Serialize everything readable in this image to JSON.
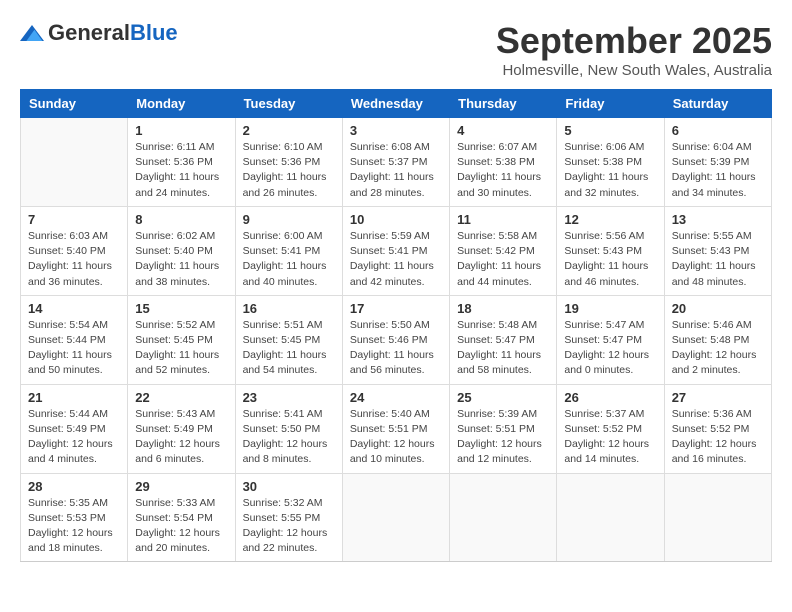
{
  "header": {
    "logo_general": "General",
    "logo_blue": "Blue",
    "month": "September 2025",
    "location": "Holmesville, New South Wales, Australia"
  },
  "weekdays": [
    "Sunday",
    "Monday",
    "Tuesday",
    "Wednesday",
    "Thursday",
    "Friday",
    "Saturday"
  ],
  "weeks": [
    [
      {
        "day": "",
        "info": ""
      },
      {
        "day": "1",
        "info": "Sunrise: 6:11 AM\nSunset: 5:36 PM\nDaylight: 11 hours\nand 24 minutes."
      },
      {
        "day": "2",
        "info": "Sunrise: 6:10 AM\nSunset: 5:36 PM\nDaylight: 11 hours\nand 26 minutes."
      },
      {
        "day": "3",
        "info": "Sunrise: 6:08 AM\nSunset: 5:37 PM\nDaylight: 11 hours\nand 28 minutes."
      },
      {
        "day": "4",
        "info": "Sunrise: 6:07 AM\nSunset: 5:38 PM\nDaylight: 11 hours\nand 30 minutes."
      },
      {
        "day": "5",
        "info": "Sunrise: 6:06 AM\nSunset: 5:38 PM\nDaylight: 11 hours\nand 32 minutes."
      },
      {
        "day": "6",
        "info": "Sunrise: 6:04 AM\nSunset: 5:39 PM\nDaylight: 11 hours\nand 34 minutes."
      }
    ],
    [
      {
        "day": "7",
        "info": "Sunrise: 6:03 AM\nSunset: 5:40 PM\nDaylight: 11 hours\nand 36 minutes."
      },
      {
        "day": "8",
        "info": "Sunrise: 6:02 AM\nSunset: 5:40 PM\nDaylight: 11 hours\nand 38 minutes."
      },
      {
        "day": "9",
        "info": "Sunrise: 6:00 AM\nSunset: 5:41 PM\nDaylight: 11 hours\nand 40 minutes."
      },
      {
        "day": "10",
        "info": "Sunrise: 5:59 AM\nSunset: 5:41 PM\nDaylight: 11 hours\nand 42 minutes."
      },
      {
        "day": "11",
        "info": "Sunrise: 5:58 AM\nSunset: 5:42 PM\nDaylight: 11 hours\nand 44 minutes."
      },
      {
        "day": "12",
        "info": "Sunrise: 5:56 AM\nSunset: 5:43 PM\nDaylight: 11 hours\nand 46 minutes."
      },
      {
        "day": "13",
        "info": "Sunrise: 5:55 AM\nSunset: 5:43 PM\nDaylight: 11 hours\nand 48 minutes."
      }
    ],
    [
      {
        "day": "14",
        "info": "Sunrise: 5:54 AM\nSunset: 5:44 PM\nDaylight: 11 hours\nand 50 minutes."
      },
      {
        "day": "15",
        "info": "Sunrise: 5:52 AM\nSunset: 5:45 PM\nDaylight: 11 hours\nand 52 minutes."
      },
      {
        "day": "16",
        "info": "Sunrise: 5:51 AM\nSunset: 5:45 PM\nDaylight: 11 hours\nand 54 minutes."
      },
      {
        "day": "17",
        "info": "Sunrise: 5:50 AM\nSunset: 5:46 PM\nDaylight: 11 hours\nand 56 minutes."
      },
      {
        "day": "18",
        "info": "Sunrise: 5:48 AM\nSunset: 5:47 PM\nDaylight: 11 hours\nand 58 minutes."
      },
      {
        "day": "19",
        "info": "Sunrise: 5:47 AM\nSunset: 5:47 PM\nDaylight: 12 hours\nand 0 minutes."
      },
      {
        "day": "20",
        "info": "Sunrise: 5:46 AM\nSunset: 5:48 PM\nDaylight: 12 hours\nand 2 minutes."
      }
    ],
    [
      {
        "day": "21",
        "info": "Sunrise: 5:44 AM\nSunset: 5:49 PM\nDaylight: 12 hours\nand 4 minutes."
      },
      {
        "day": "22",
        "info": "Sunrise: 5:43 AM\nSunset: 5:49 PM\nDaylight: 12 hours\nand 6 minutes."
      },
      {
        "day": "23",
        "info": "Sunrise: 5:41 AM\nSunset: 5:50 PM\nDaylight: 12 hours\nand 8 minutes."
      },
      {
        "day": "24",
        "info": "Sunrise: 5:40 AM\nSunset: 5:51 PM\nDaylight: 12 hours\nand 10 minutes."
      },
      {
        "day": "25",
        "info": "Sunrise: 5:39 AM\nSunset: 5:51 PM\nDaylight: 12 hours\nand 12 minutes."
      },
      {
        "day": "26",
        "info": "Sunrise: 5:37 AM\nSunset: 5:52 PM\nDaylight: 12 hours\nand 14 minutes."
      },
      {
        "day": "27",
        "info": "Sunrise: 5:36 AM\nSunset: 5:52 PM\nDaylight: 12 hours\nand 16 minutes."
      }
    ],
    [
      {
        "day": "28",
        "info": "Sunrise: 5:35 AM\nSunset: 5:53 PM\nDaylight: 12 hours\nand 18 minutes."
      },
      {
        "day": "29",
        "info": "Sunrise: 5:33 AM\nSunset: 5:54 PM\nDaylight: 12 hours\nand 20 minutes."
      },
      {
        "day": "30",
        "info": "Sunrise: 5:32 AM\nSunset: 5:55 PM\nDaylight: 12 hours\nand 22 minutes."
      },
      {
        "day": "",
        "info": ""
      },
      {
        "day": "",
        "info": ""
      },
      {
        "day": "",
        "info": ""
      },
      {
        "day": "",
        "info": ""
      }
    ]
  ]
}
